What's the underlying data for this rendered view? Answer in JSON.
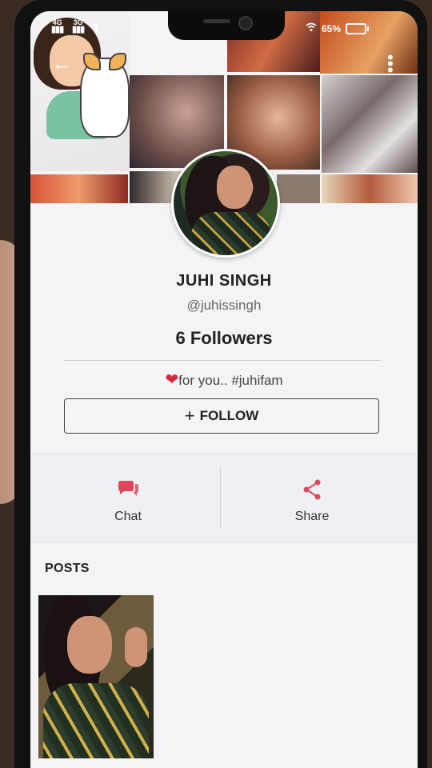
{
  "status_bar": {
    "net1": "4G",
    "net2": "3G",
    "time": "1",
    "battery_text": "65%"
  },
  "profile": {
    "name": "JUHI SINGH",
    "handle": "@juhissingh",
    "followers": "6 Followers",
    "bio_heart": "❤",
    "bio_text": "for you.. #juhifam",
    "follow_label": "FOLLOW",
    "follow_icon": "plus-icon"
  },
  "actions": {
    "chat_label": "Chat",
    "share_label": "Share"
  },
  "posts": {
    "title": "POSTS"
  },
  "colors": {
    "accent": "#e0455a",
    "heart": "#d9253a"
  }
}
